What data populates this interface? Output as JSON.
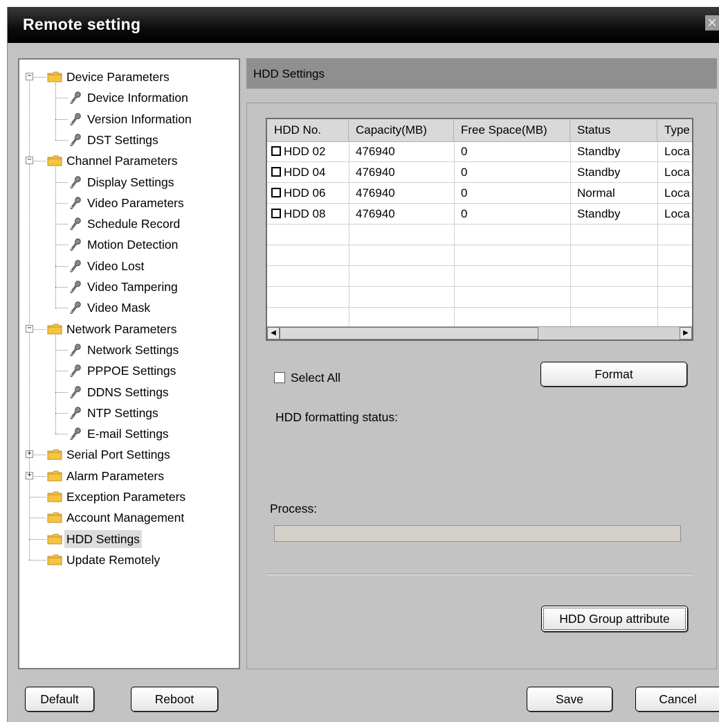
{
  "window": {
    "title": "Remote setting",
    "close_glyph": "✕"
  },
  "tree": {
    "items": [
      {
        "label": "Device Parameters",
        "type": "folder",
        "expander": "−"
      },
      {
        "label": "Device Information",
        "type": "tool"
      },
      {
        "label": "Version Information",
        "type": "tool"
      },
      {
        "label": "DST Settings",
        "type": "tool"
      },
      {
        "label": "Channel Parameters",
        "type": "folder",
        "expander": "−"
      },
      {
        "label": "Display Settings",
        "type": "tool"
      },
      {
        "label": "Video Parameters",
        "type": "tool"
      },
      {
        "label": "Schedule Record",
        "type": "tool"
      },
      {
        "label": "Motion Detection",
        "type": "tool"
      },
      {
        "label": "Video Lost",
        "type": "tool"
      },
      {
        "label": "Video Tampering",
        "type": "tool"
      },
      {
        "label": "Video Mask",
        "type": "tool"
      },
      {
        "label": "Network Parameters",
        "type": "folder",
        "expander": "−"
      },
      {
        "label": "Network Settings",
        "type": "tool"
      },
      {
        "label": "PPPOE Settings",
        "type": "tool"
      },
      {
        "label": "DDNS Settings",
        "type": "tool"
      },
      {
        "label": "NTP Settings",
        "type": "tool"
      },
      {
        "label": "E-mail Settings",
        "type": "tool"
      },
      {
        "label": "Serial Port Settings",
        "type": "folder",
        "expander": "+"
      },
      {
        "label": "Alarm Parameters",
        "type": "folder",
        "expander": "+"
      },
      {
        "label": "Exception Parameters",
        "type": "folder"
      },
      {
        "label": "Account Management",
        "type": "folder"
      },
      {
        "label": "HDD Settings",
        "type": "folder",
        "selected": true
      },
      {
        "label": "Update Remotely",
        "type": "folder"
      }
    ]
  },
  "section": {
    "title": "HDD Settings"
  },
  "table": {
    "columns": [
      "HDD No.",
      "Capacity(MB)",
      "Free Space(MB)",
      "Status",
      "Type"
    ],
    "rows": [
      [
        "HDD 02",
        "476940",
        "0",
        "Standby",
        "Local"
      ],
      [
        "HDD 04",
        "476940",
        "0",
        "Standby",
        "Local"
      ],
      [
        "HDD 06",
        "476940",
        "0",
        "Normal",
        "Local"
      ],
      [
        "HDD 08",
        "476940",
        "0",
        "Standby",
        "Local"
      ]
    ]
  },
  "select_all_label": "Select All",
  "format_button": "Format",
  "formatting_status_label": "HDD formatting status:",
  "process_label": "Process:",
  "process_fraction": 0,
  "hdd_group_button": "HDD Group attribute",
  "footer": {
    "default_button": "Default",
    "reboot_button": "Reboot",
    "save_button": "Save",
    "cancel_button": "Cancel"
  },
  "colors": {
    "folder_fill": "#f5c542",
    "folder_edge": "#c0902a",
    "tool_fill": "#8a8a8a"
  }
}
